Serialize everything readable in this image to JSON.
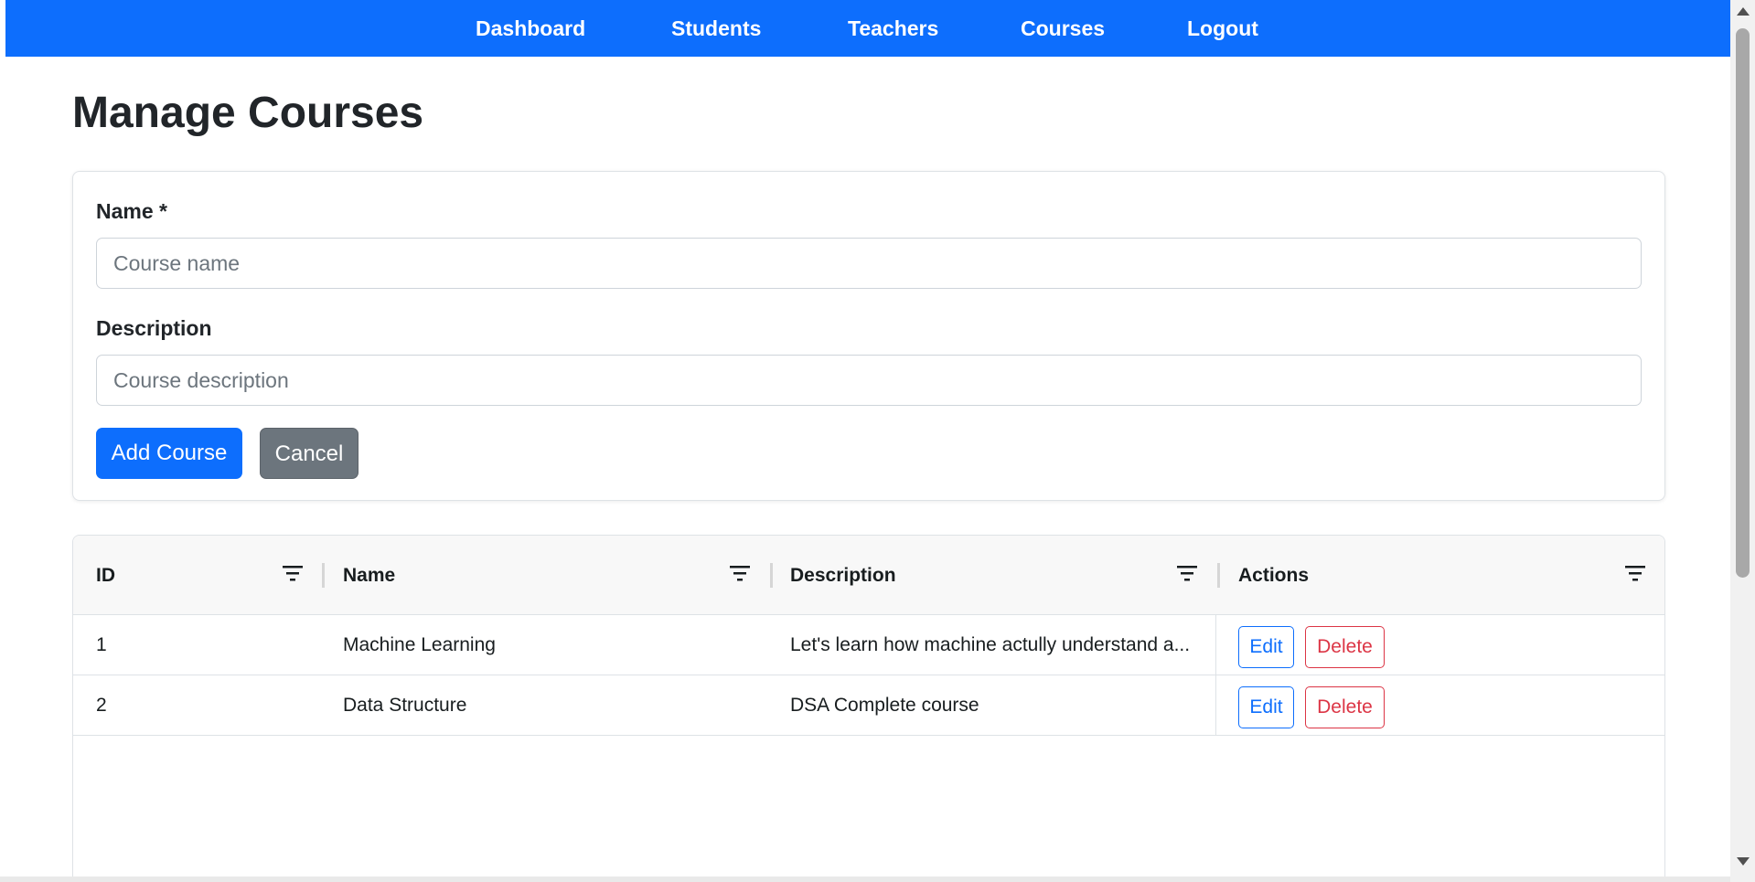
{
  "nav": {
    "items": [
      {
        "label": "Dashboard"
      },
      {
        "label": "Students"
      },
      {
        "label": "Teachers"
      },
      {
        "label": "Courses"
      },
      {
        "label": "Logout"
      }
    ]
  },
  "page": {
    "title": "Manage Courses"
  },
  "form": {
    "name_label": "Name *",
    "name_value": "",
    "name_placeholder": "Course name",
    "description_label": "Description",
    "description_value": "",
    "description_placeholder": "Course description",
    "add_button": "Add Course",
    "cancel_button": "Cancel"
  },
  "table": {
    "columns": [
      "ID",
      "Name",
      "Description",
      "Actions"
    ],
    "rows": [
      {
        "id": "1",
        "name": "Machine Learning",
        "description": "Let's learn how machine actully understand a..."
      },
      {
        "id": "2",
        "name": "Data Structure",
        "description": "DSA Complete course"
      }
    ],
    "edit_label": "Edit",
    "delete_label": "Delete"
  },
  "colors": {
    "primary": "#0d6efd",
    "secondary": "#6c757d",
    "danger": "#dc3545"
  },
  "icons": {
    "column_menu": "filter-lines-icon"
  }
}
